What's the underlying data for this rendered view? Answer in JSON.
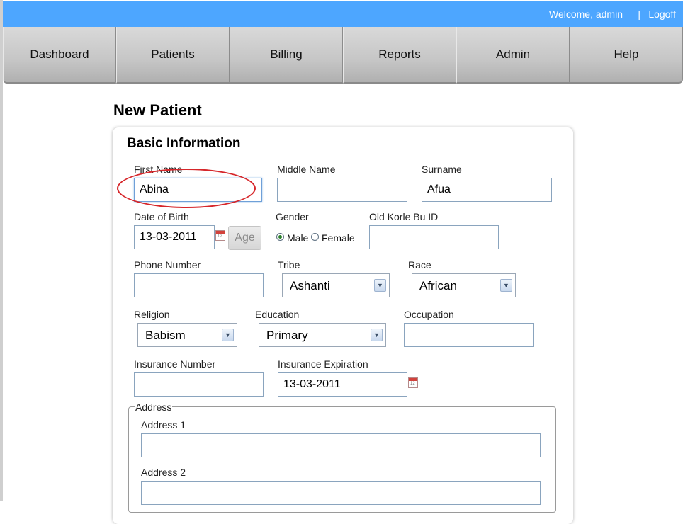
{
  "header": {
    "welcome": "Welcome, admin",
    "separator": "|",
    "logoff": "Logoff",
    "bar_color": "#4da6ff"
  },
  "nav": [
    "Dashboard",
    "Patients",
    "Billing",
    "Reports",
    "Admin",
    "Help"
  ],
  "page": {
    "title": "New Patient",
    "section": "Basic Information"
  },
  "form": {
    "first_name": {
      "label": "First Name",
      "value": "Abina"
    },
    "middle_name": {
      "label": "Middle Name",
      "value": ""
    },
    "surname": {
      "label": "Surname",
      "value": "Afua"
    },
    "dob": {
      "label": "Date of Birth",
      "value": "13-03-2011"
    },
    "age_button": "Age",
    "gender": {
      "label": "Gender",
      "male": "Male",
      "female": "Female",
      "selected": "Male"
    },
    "old_id": {
      "label": "Old Korle Bu ID",
      "value": ""
    },
    "phone": {
      "label": "Phone Number",
      "value": ""
    },
    "tribe": {
      "label": "Tribe",
      "value": "Ashanti"
    },
    "race": {
      "label": "Race",
      "value": "African"
    },
    "religion": {
      "label": "Religion",
      "value": "Babism"
    },
    "education": {
      "label": "Education",
      "value": "Primary"
    },
    "occupation": {
      "label": "Occupation",
      "value": ""
    },
    "insurance_number": {
      "label": "Insurance Number",
      "value": ""
    },
    "insurance_expiration": {
      "label": "Insurance Expiration",
      "value": "13-03-2011"
    },
    "address": {
      "legend": "Address",
      "address1": {
        "label": "Address 1",
        "value": ""
      },
      "address2": {
        "label": "Address 2",
        "value": ""
      }
    }
  },
  "icons": {
    "calendar": "calendar-icon",
    "dropdown": "chevron-down-icon"
  },
  "annotation_color": "#d6262a"
}
